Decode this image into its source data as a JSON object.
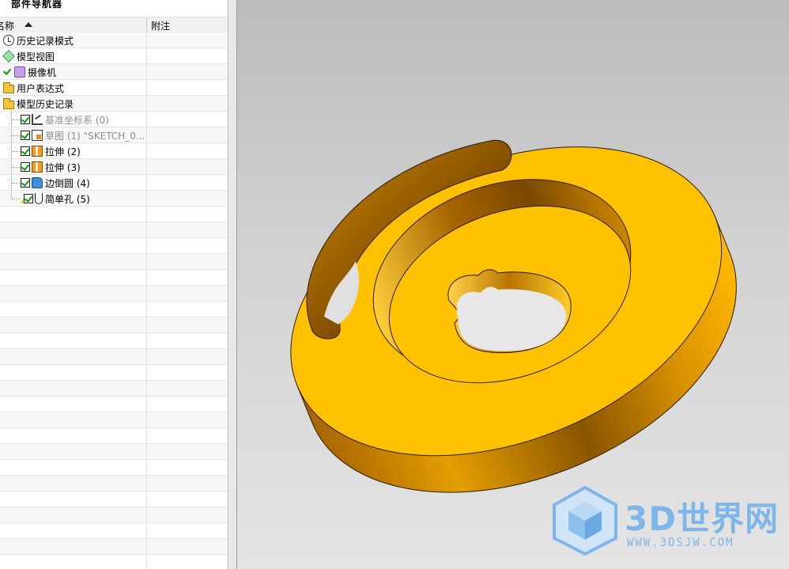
{
  "navigator": {
    "title": "部件导航器",
    "columns": {
      "name": "名称",
      "note": "附注"
    },
    "rows": [
      {
        "label": "历史记录模式",
        "icon": "clock-icon",
        "checked": false,
        "greyed": false,
        "indent": 0
      },
      {
        "label": "模型视图",
        "icon": "cube-view-icon",
        "checked": false,
        "greyed": false,
        "indent": 0
      },
      {
        "label": "摄像机",
        "icon": "camera-icon",
        "checked": true,
        "greyed": false,
        "indent": 0
      },
      {
        "label": "用户表达式",
        "icon": "folder-icon",
        "checked": false,
        "greyed": false,
        "indent": 0
      },
      {
        "label": "模型历史记录",
        "icon": "folder-open-icon",
        "checked": false,
        "greyed": false,
        "indent": 0
      },
      {
        "label": "基准坐标系 (0)",
        "icon": "csys-icon",
        "checked": true,
        "greyed": true,
        "indent": 1
      },
      {
        "label": "草图 (1) \"SKETCH_0...",
        "icon": "sketch-icon",
        "checked": true,
        "greyed": true,
        "indent": 1
      },
      {
        "label": "拉伸 (2)",
        "icon": "extrude-icon",
        "checked": true,
        "greyed": false,
        "indent": 1
      },
      {
        "label": "拉伸 (3)",
        "icon": "extrude-icon",
        "checked": true,
        "greyed": false,
        "indent": 1
      },
      {
        "label": "边倒圆 (4)",
        "icon": "blend-icon",
        "checked": true,
        "greyed": false,
        "indent": 1
      },
      {
        "label": "简单孔 (5)",
        "icon": "hole-icon",
        "checked": true,
        "greyed": false,
        "indent": 1,
        "warning": true
      }
    ],
    "empty_rows": 23
  },
  "viewport": {
    "part_color": "#FFC100",
    "background": "gradient-grey"
  },
  "watermark": {
    "brand": "3D世界网",
    "url": "WWW.3DSJW.COM",
    "color": "#7fb6ea"
  }
}
